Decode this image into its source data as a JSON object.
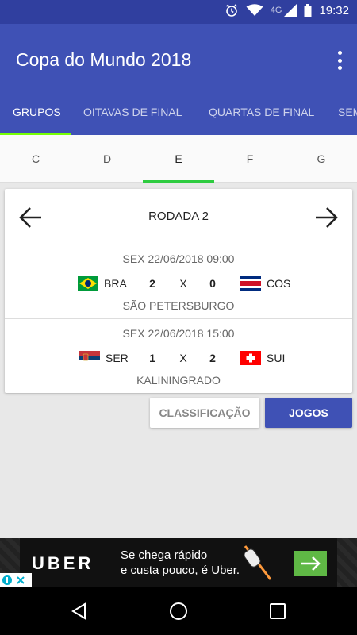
{
  "status_bar": {
    "time": "19:32",
    "network": "4G",
    "icons": [
      "alarm-icon",
      "wifi-icon",
      "signal-icon",
      "battery-icon"
    ]
  },
  "app_bar": {
    "title": "Copa do Mundo 2018",
    "menu_icon": "more-vert-icon"
  },
  "tabs": [
    {
      "label": "GRUPOS",
      "active": true
    },
    {
      "label": "OITAVAS DE FINAL",
      "active": false
    },
    {
      "label": "QUARTAS DE FINAL",
      "active": false
    },
    {
      "label": "SEM",
      "active": false
    }
  ],
  "group_tabs": [
    {
      "label": "C",
      "active": false
    },
    {
      "label": "D",
      "active": false
    },
    {
      "label": "E",
      "active": true
    },
    {
      "label": "F",
      "active": false
    },
    {
      "label": "G",
      "active": false
    }
  ],
  "round": {
    "label": "RODADA 2",
    "prev_icon": "arrow-left-icon",
    "next_icon": "arrow-right-icon"
  },
  "matches": [
    {
      "date": "SEX 22/06/2018 09:00",
      "home_code": "BRA",
      "home_score": "2",
      "separator": "X",
      "away_score": "0",
      "away_code": "COS",
      "venue": "SÃO PETERSBURGO",
      "home_flag": "brazil-flag-icon",
      "away_flag": "costa-rica-flag-icon"
    },
    {
      "date": "SEX 22/06/2018 15:00",
      "home_code": "SER",
      "home_score": "1",
      "separator": "X",
      "away_score": "2",
      "away_code": "SUI",
      "venue": "KALININGRADO",
      "home_flag": "serbia-flag-icon",
      "away_flag": "switzerland-flag-icon"
    }
  ],
  "buttons": {
    "standings": "CLASSIFICAÇÃO",
    "games": "JOGOS"
  },
  "ad": {
    "brand": "UBER",
    "copy_line1": "Se chega rápido",
    "copy_line2": "e custa pouco, é Uber.",
    "cta_icon": "arrow-right-icon"
  },
  "colors": {
    "primary": "#3f51b5",
    "primary_dark": "#303f9f",
    "tab_indicator": "#76ff03",
    "group_indicator": "#2ecc40"
  }
}
